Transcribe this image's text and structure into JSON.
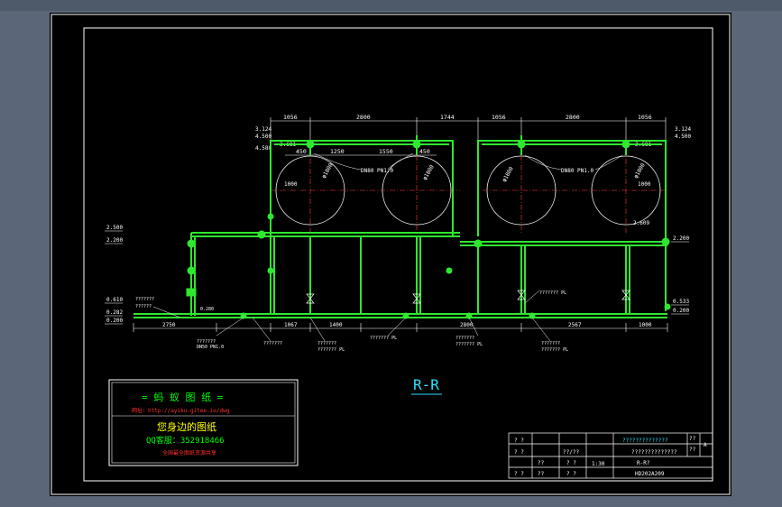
{
  "colors": {
    "background": "#5b6678",
    "sheet": "#000000",
    "border": "#ffffff",
    "pipe": "#2ee82e",
    "dimension": "#ffffff",
    "center_line": "#ff4040",
    "ad_red": "#ff3030",
    "ad_green": "#00ff00",
    "ad_yellow": "#ffff00",
    "title_cyan": "#30e0ff"
  },
  "drawing": {
    "section_label": "R-R",
    "top_dimensions": [
      "1056",
      "2800",
      "1744",
      "1056",
      "2800",
      "1056"
    ],
    "sub_dimensions": [
      "450",
      "1250",
      "1550",
      "450"
    ],
    "bottom_dimensions": [
      "2750",
      "1067",
      "1400",
      "2800",
      "2567",
      "1000"
    ],
    "tank_dims": [
      "1000",
      "1000"
    ],
    "tank_diameter_left": "φ1800",
    "tank_diameter_right": "φ1800",
    "tank_diameter_a": "φ1800",
    "tank_diameter_b": "φ1800",
    "nozzle_left": "DN80 PN1.0",
    "nozzle_right": "DN80 PN1.0",
    "elev_left": [
      "2.500",
      "2.200",
      "0.610",
      "0.282",
      "0.200"
    ],
    "elev_top_left": [
      "3.124",
      "4.500",
      "4.580"
    ],
    "elev_top_right": [
      "3.124",
      "4.500"
    ],
    "elev_right": [
      "2.200",
      "0.533",
      "0.200"
    ],
    "elev_tank_marks": [
      "3.681",
      "3.681",
      "2.609"
    ],
    "pipe_callouts": [
      "???????",
      "??????",
      "DN50 PN1.0",
      "???????",
      "???????",
      "???????",
      "??????? PL",
      "??????? PL",
      "???????",
      "??????? PL",
      "???????",
      "??????? PL",
      "??????? PL",
      "0.280"
    ]
  },
  "ad_box": {
    "title": "= 蚂 蚁 图 纸 =",
    "url_line": "网址：http://ayiku.gitee.io/dwg",
    "slogan": "您身边的图纸",
    "qq_line": "QQ客服：352918466",
    "footer": "全国最全图纸资源共享"
  },
  "title_block": {
    "project": "??????????????",
    "drawing_name": "??????????????",
    "code": "R-R?",
    "scale": "1:30",
    "drawing_no": "HD202A209",
    "sheet_a": "??",
    "sheet_b": "??",
    "rev": "A",
    "cells": [
      "? ?",
      "? ?",
      "? ?",
      "??/??",
      "? ?",
      "? ?",
      "??",
      "??"
    ]
  }
}
